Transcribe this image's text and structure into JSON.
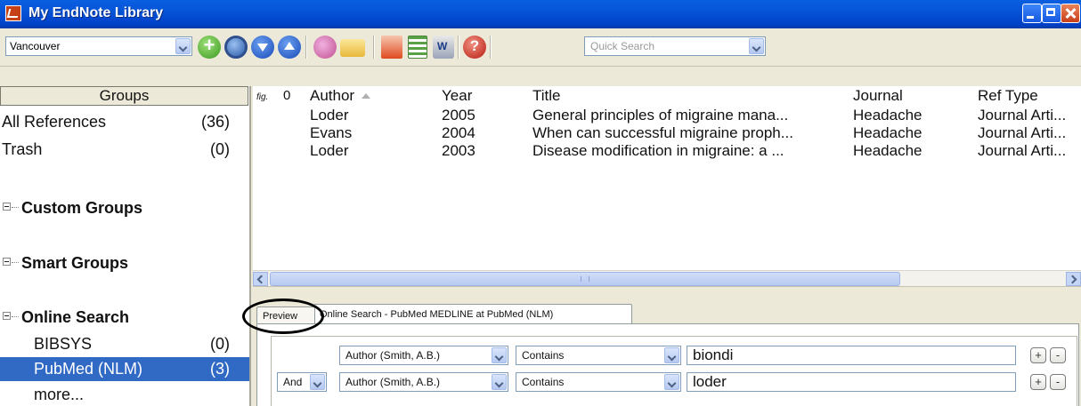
{
  "window": {
    "title": "My EndNote Library"
  },
  "toolbar": {
    "style_select": "Vancouver",
    "quick_search_placeholder": "Quick Search",
    "icons": [
      "new-reference-icon",
      "online-search-icon",
      "import-icon",
      "export-icon",
      "connect-icon",
      "open-link-icon",
      "open-pdf-icon",
      "format-bibliography-icon",
      "return-to-word-icon",
      "help-icon"
    ]
  },
  "groups": {
    "header": "Groups",
    "all_references": {
      "label": "All References",
      "count": "(36)"
    },
    "trash": {
      "label": "Trash",
      "count": "(0)"
    },
    "custom_groups": "Custom Groups",
    "smart_groups": "Smart Groups",
    "online_search": "Online Search",
    "online_items": [
      {
        "label": "BIBSYS",
        "count": "(0)"
      },
      {
        "label": "PubMed (NLM)",
        "count": "(3)",
        "selected": true
      },
      {
        "label": "more...",
        "count": ""
      }
    ]
  },
  "references": {
    "columns": {
      "figure": "fig.",
      "attachment": "0",
      "author": "Author",
      "year": "Year",
      "title": "Title",
      "journal": "Journal",
      "ref_type": "Ref Type"
    },
    "rows": [
      {
        "author": "Loder",
        "year": "2005",
        "title": "General principles of migraine mana...",
        "journal": "Headache",
        "ref_type": "Journal Arti..."
      },
      {
        "author": "Evans",
        "year": "2004",
        "title": "When can successful migraine proph...",
        "journal": "Headache",
        "ref_type": "Journal Arti..."
      },
      {
        "author": "Loder",
        "year": "2003",
        "title": "Disease modification in migraine: a ...",
        "journal": "Headache",
        "ref_type": "Journal Arti..."
      }
    ]
  },
  "bottom": {
    "tabs": {
      "preview": "Preview",
      "online": "Online Search - PubMed MEDLINE at PubMed (NLM)"
    },
    "search_rows": [
      {
        "bool": "",
        "field": "Author (Smith, A.B.)",
        "op": "Contains",
        "term": "biondi"
      },
      {
        "bool": "And",
        "field": "Author (Smith, A.B.)",
        "op": "Contains",
        "term": "loder"
      }
    ],
    "plus": "+",
    "minus": "-"
  }
}
